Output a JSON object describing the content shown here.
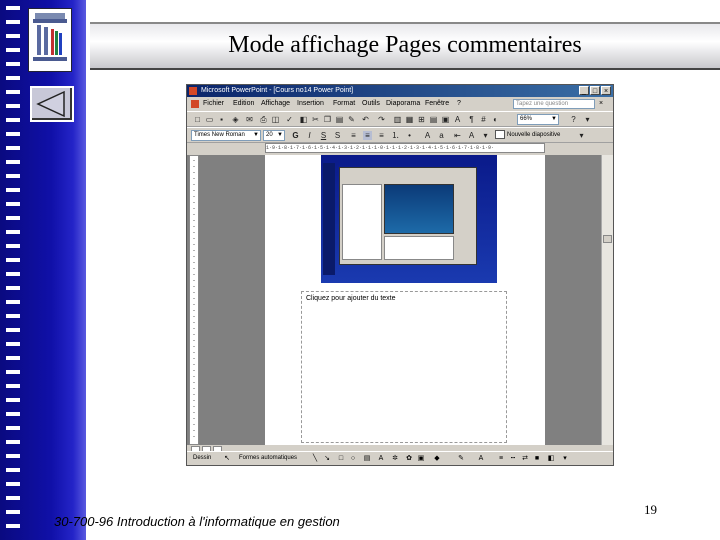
{
  "slide": {
    "title": "Mode affichage Pages commentaires",
    "footer": "30-700-96 Introduction à l'informatique en gestion",
    "page_number": "19"
  },
  "nav": {
    "back_icon": "left-triangle-icon",
    "logo_icon": "building-books-logo-icon"
  },
  "window": {
    "title": "Microsoft PowerPoint - [Cours no14 Power Point]",
    "controls": [
      "_",
      "□",
      "×"
    ]
  },
  "menu": {
    "items": [
      "Fichier",
      "Edition",
      "Affichage",
      "Insertion",
      "Format",
      "Outils",
      "Diaporama",
      "Fenêtre",
      "?"
    ],
    "ask_placeholder": "Tapez une question",
    "close": "×"
  },
  "toolbar": {
    "zoom": "66%"
  },
  "format_toolbar": {
    "font": "Times New Roman",
    "size": "20",
    "bold": "G",
    "italic": "I",
    "underline": "S",
    "shadow": "S",
    "new_slide": "Nouvelle diapositive"
  },
  "ruler": {
    "text": "1·9·1·8·1·7·1·6·1·5·1·4·1·3·1·2·1·1·1·0·1·1·1·2·1·3·1·4·1·5·1·6·1·7·1·8·1·9·"
  },
  "notes": {
    "placeholder": "Cliquez pour ajouter du texte"
  },
  "drawing": {
    "draw_label": "Dessin",
    "autoshapes_label": "Formes automatiques"
  },
  "colors": {
    "titlebar": "#0a246a",
    "leftbar": "#1010a8",
    "slide_bg": "#1a3ab0"
  }
}
